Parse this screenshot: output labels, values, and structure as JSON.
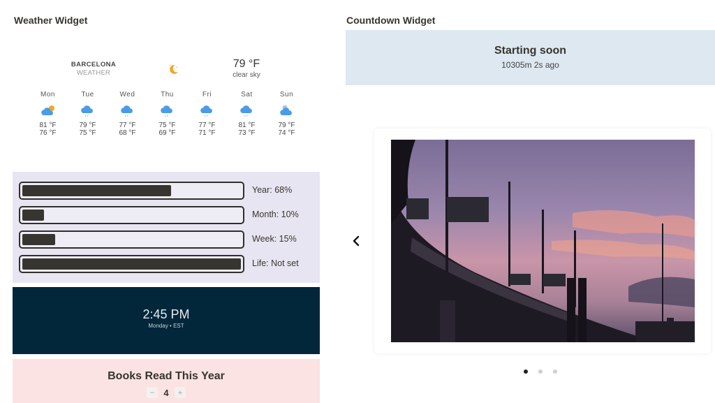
{
  "weather_widget": {
    "title": "Weather Widget",
    "city": "BARCELONA",
    "subtitle": "WEATHER",
    "current_icon": "moon-icon",
    "current_temp": "79 °F",
    "current_desc": "clear sky",
    "forecast": [
      {
        "day": "Mon",
        "icon": "cloud-sun-icon",
        "high": "81 °F",
        "low": "76 °F"
      },
      {
        "day": "Tue",
        "icon": "cloud-rain-icon",
        "high": "79 °F",
        "low": "75 °F"
      },
      {
        "day": "Wed",
        "icon": "cloud-rain-icon",
        "high": "77 °F",
        "low": "68 °F"
      },
      {
        "day": "Thu",
        "icon": "cloud-rain-icon",
        "high": "75 °F",
        "low": "69 °F"
      },
      {
        "day": "Fri",
        "icon": "cloud-rain-icon",
        "high": "77 °F",
        "low": "71 °F"
      },
      {
        "day": "Sat",
        "icon": "cloud-rain-icon",
        "high": "81 °F",
        "low": "73 °F"
      },
      {
        "day": "Sun",
        "icon": "cloud-moon-icon",
        "high": "79 °F",
        "low": "74 °F"
      }
    ]
  },
  "progress_widget": {
    "bars": [
      {
        "label": "Year: 68%",
        "fraction": 0.68
      },
      {
        "label": "Month: 10%",
        "fraction": 0.1
      },
      {
        "label": "Week: 15%",
        "fraction": 0.15
      },
      {
        "label": "Life: Not set",
        "fraction": 1.0
      }
    ]
  },
  "clock_widget": {
    "time": "2:45 PM",
    "subtitle": "Monday • EST"
  },
  "books_widget": {
    "title": "Books Read This Year",
    "count": "4",
    "decrement_label": "−",
    "increment_label": "+"
  },
  "countdown_widget": {
    "title": "Countdown Widget",
    "heading": "Starting soon",
    "elapsed": "10305m 2s ago"
  },
  "carousel": {
    "prev_icon": "chevron-left-icon",
    "image_desc": "highway overpass at sunset",
    "slide_count": 3,
    "active_slide": 1
  },
  "colors": {
    "progress_bg": "#e8e5f2",
    "clock_bg": "#02263a",
    "books_bg": "#fae3e2",
    "countdown_bg": "#dde8f0",
    "weather_accent": "#4a9be8",
    "sun_accent": "#f5a623"
  }
}
